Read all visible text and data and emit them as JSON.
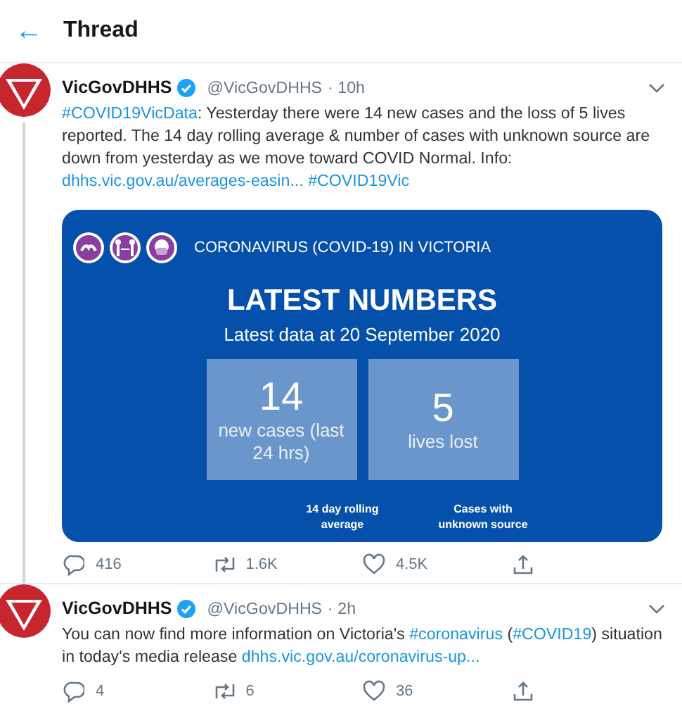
{
  "header": {
    "back": "←",
    "title": "Thread"
  },
  "tweets": [
    {
      "name": "VicGovDHHS",
      "handle": "@VicGovDHHS",
      "time": "· 10h",
      "has_line": true,
      "text": [
        {
          "kind": "link",
          "text": "#COVID19VicData"
        },
        {
          "kind": "text",
          "text": ": Yesterday there were 14 new cases and the loss of 5 lives reported. The 14 day rolling average & number of cases with unknown source are down from yesterday as we move toward COVID Normal. Info: "
        },
        {
          "kind": "link",
          "text": "dhhs.vic.gov.au/averages-easin..."
        },
        {
          "kind": "link",
          "text": "#COVID19Vic"
        }
      ],
      "card": {
        "banner": "CORONAVIRUS (COVID-19) IN VICTORIA",
        "heading": "LATEST NUMBERS",
        "subheading": "Latest data at 20 September 2020",
        "stats": [
          {
            "value": "14",
            "label": "new cases (last 24 hrs)"
          },
          {
            "value": "5",
            "label": "lives lost"
          }
        ],
        "footer_labels": [
          "14 day rolling average",
          "Cases with unknown source"
        ]
      },
      "replies": "416",
      "retweets": "1.6K",
      "likes": "4.5K"
    },
    {
      "name": "VicGovDHHS",
      "handle": "@VicGovDHHS",
      "time": "· 2h",
      "has_line": false,
      "text": [
        {
          "kind": "text",
          "text": "You can now find more information on Victoria's "
        },
        {
          "kind": "link",
          "text": "#coronavirus"
        },
        {
          "kind": "text",
          "text": " ("
        },
        {
          "kind": "link",
          "text": "#COVID19"
        },
        {
          "kind": "text",
          "text": ") situation in today's media release "
        },
        {
          "kind": "link",
          "text": "dhhs.vic.gov.au/coronavirus-up..."
        }
      ],
      "replies": "4",
      "retweets": "6",
      "likes": "36"
    }
  ]
}
